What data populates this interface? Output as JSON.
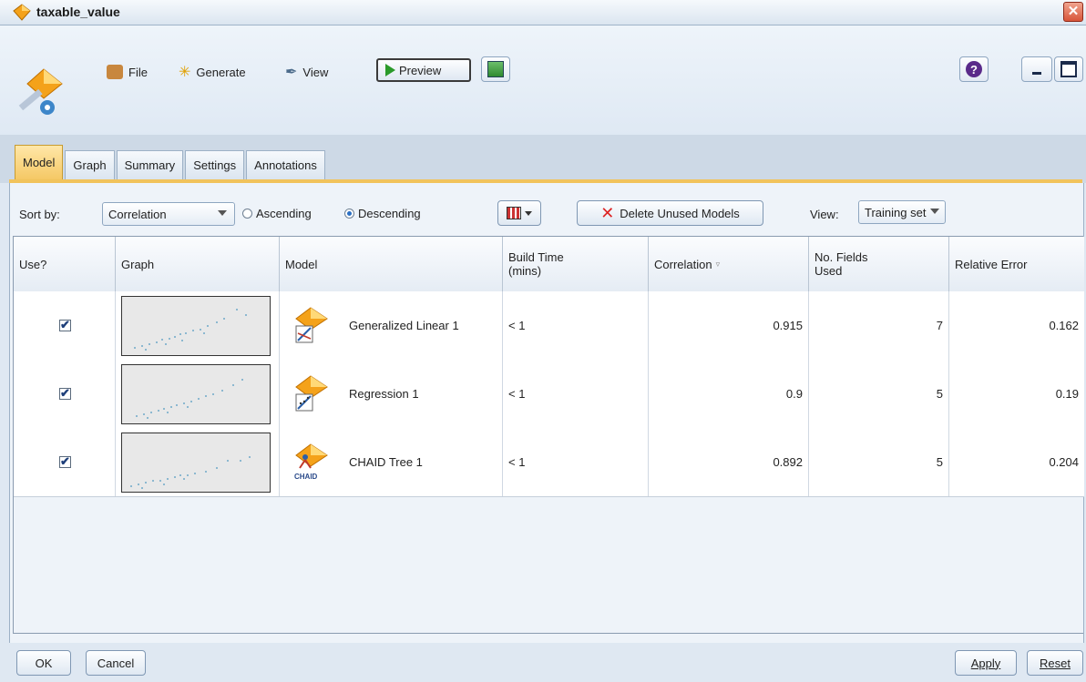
{
  "window": {
    "title": "taxable_value",
    "close_icon": "close-icon"
  },
  "menu": {
    "file": "File",
    "generate": "Generate",
    "view": "View",
    "preview": "Preview"
  },
  "tabs": [
    {
      "label": "Model",
      "active": true
    },
    {
      "label": "Graph"
    },
    {
      "label": "Summary"
    },
    {
      "label": "Settings"
    },
    {
      "label": "Annotations"
    }
  ],
  "toolbar": {
    "sort_by_label": "Sort by:",
    "sort_by_value": "Correlation",
    "ascending": "Ascending",
    "descending": "Descending",
    "sort_order_selected": "Descending",
    "delete_unused": "Delete Unused Models",
    "view_label": "View:",
    "view_value": "Training set"
  },
  "table": {
    "headers": {
      "use": "Use?",
      "graph": "Graph",
      "model": "Model",
      "build_time_1": "Build Time",
      "build_time_2": "(mins)",
      "correlation": "Correlation",
      "fields_1": "No. Fields",
      "fields_2": "Used",
      "relative_error": "Relative Error"
    },
    "rows": [
      {
        "use": true,
        "model": "Generalized Linear 1",
        "build_time": "< 1",
        "correlation": "0.915",
        "fields": "7",
        "relative_error": "0.162"
      },
      {
        "use": true,
        "model": "Regression 1",
        "build_time": "< 1",
        "correlation": "0.9",
        "fields": "5",
        "relative_error": "0.19"
      },
      {
        "use": true,
        "model": "CHAID Tree 1",
        "build_time": "< 1",
        "correlation": "0.892",
        "fields": "5",
        "relative_error": "0.204"
      }
    ]
  },
  "footer": {
    "ok": "OK",
    "cancel": "Cancel",
    "apply": "Apply",
    "reset": "Reset"
  },
  "colors": {
    "accent_tab": "#f5c865",
    "header_bg": "#dfe9f4"
  }
}
